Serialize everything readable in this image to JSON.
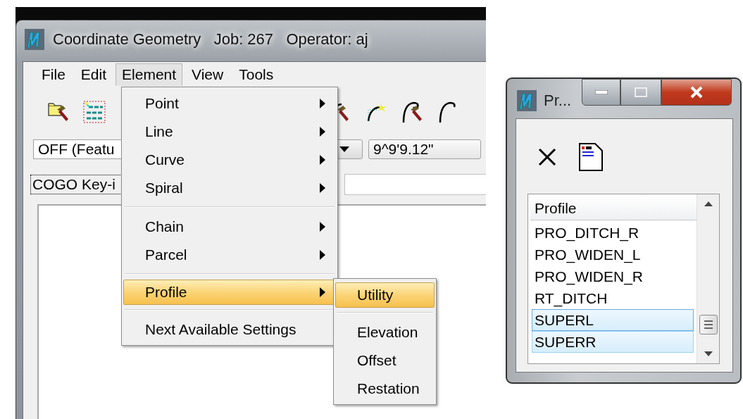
{
  "main_window": {
    "title": "Coordinate Geometry   Job: 267   Operator: aj",
    "menu_bar": [
      {
        "label": "File",
        "selected": false
      },
      {
        "label": "Edit",
        "selected": false
      },
      {
        "label": "Element",
        "selected": true
      },
      {
        "label": "View",
        "selected": false
      },
      {
        "label": "Tools",
        "selected": false
      }
    ],
    "fields": [
      {
        "value": "OFF (Featu"
      },
      {
        "value": "9^9'9.12\""
      }
    ],
    "keyin": {
      "label": "COGO Key-i"
    }
  },
  "element_menu": {
    "items": [
      {
        "kind": "item",
        "label": "Point",
        "submenu": true,
        "selected": false
      },
      {
        "kind": "item",
        "label": "Line",
        "submenu": true,
        "selected": false
      },
      {
        "kind": "item",
        "label": "Curve",
        "submenu": true,
        "selected": false
      },
      {
        "kind": "item",
        "label": "Spiral",
        "submenu": true,
        "selected": false
      },
      {
        "kind": "separator"
      },
      {
        "kind": "item",
        "label": "Chain",
        "submenu": true,
        "selected": false
      },
      {
        "kind": "item",
        "label": "Parcel",
        "submenu": true,
        "selected": false
      },
      {
        "kind": "separator"
      },
      {
        "kind": "item",
        "label": "Profile",
        "submenu": true,
        "selected": true
      },
      {
        "kind": "separator"
      },
      {
        "kind": "item",
        "label": "Next Available Settings",
        "submenu": false,
        "selected": false
      }
    ]
  },
  "profile_submenu": {
    "items": [
      {
        "kind": "item",
        "label": "Utility",
        "submenu": false,
        "selected": true
      },
      {
        "kind": "separator"
      },
      {
        "kind": "item",
        "label": "Elevation",
        "submenu": false,
        "selected": false
      },
      {
        "kind": "item",
        "label": "Offset",
        "submenu": false,
        "selected": false
      },
      {
        "kind": "item",
        "label": "Restation",
        "submenu": false,
        "selected": false
      }
    ]
  },
  "profile_window": {
    "title": "Pr...",
    "list": {
      "header": "Profile",
      "rows": [
        {
          "label": "PRO_DITCH_R",
          "selected": false,
          "focused": false
        },
        {
          "label": "PRO_WIDEN_L",
          "selected": false,
          "focused": false
        },
        {
          "label": "PRO_WIDEN_R",
          "selected": false,
          "focused": false
        },
        {
          "label": "RT_DITCH",
          "selected": false,
          "focused": false
        },
        {
          "label": "SUPERL",
          "selected": true,
          "focused": true
        },
        {
          "label": "SUPERR",
          "selected": true,
          "focused": false
        }
      ]
    }
  }
}
